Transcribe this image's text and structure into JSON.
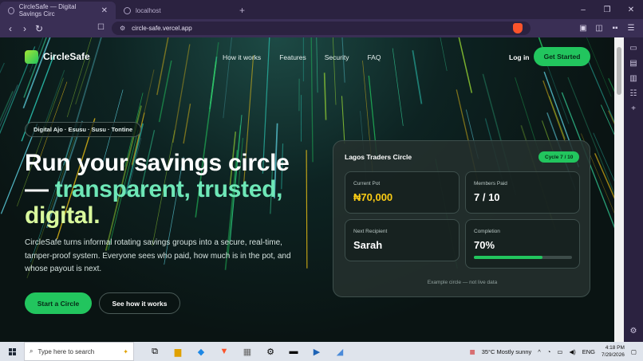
{
  "browser": {
    "tabs": [
      {
        "title": "CircleSafe — Digital Savings Circ",
        "active": true
      },
      {
        "title": "localhost",
        "active": false
      }
    ],
    "new_tab": "+",
    "url": "circle-safe.vercel.app",
    "window_controls": {
      "minimize": "–",
      "maximize": "❐",
      "close": "✕"
    }
  },
  "site": {
    "logo": "CircleSafe",
    "nav": [
      "How it works",
      "Features",
      "Security",
      "FAQ"
    ],
    "login": "Log in",
    "cta": "Get Started",
    "pill": "Digital Ajo · Esusu · Susu · Tontine",
    "headline": {
      "line1": "Run your savings circle",
      "line2_prefix": "— ",
      "line2_grad": "transparent, trusted,",
      "line3": "digital."
    },
    "lead": "CircleSafe turns informal rotating savings groups into a secure, real-time, tamper-proof system. Everyone sees who paid, how much is in the pot, and whose payout is next.",
    "primary_button": "Start a Circle",
    "secondary_button": "See how it works",
    "card": {
      "title": "Lagos Traders Circle",
      "badge": "Cycle 7 / 10",
      "stats": {
        "pot_label": "Current Pot",
        "pot_value": "₦70,000",
        "members_label": "Members Paid",
        "members_value": "7 / 10",
        "recipient_label": "Next Recipient",
        "recipient_value": "Sarah",
        "completion_label": "Completion",
        "completion_value": "70%",
        "completion_fraction": 0.7
      },
      "note": "Example circle — not live data"
    }
  },
  "taskbar": {
    "search_placeholder": "Type here to search",
    "weather": "35°C  Mostly sunny",
    "lang": "ENG",
    "time": "4:18 PM",
    "date": "7/29/2026"
  },
  "colors": {
    "accent": "#22c55e",
    "gold": "#facc15",
    "brave": "#fb542b"
  }
}
